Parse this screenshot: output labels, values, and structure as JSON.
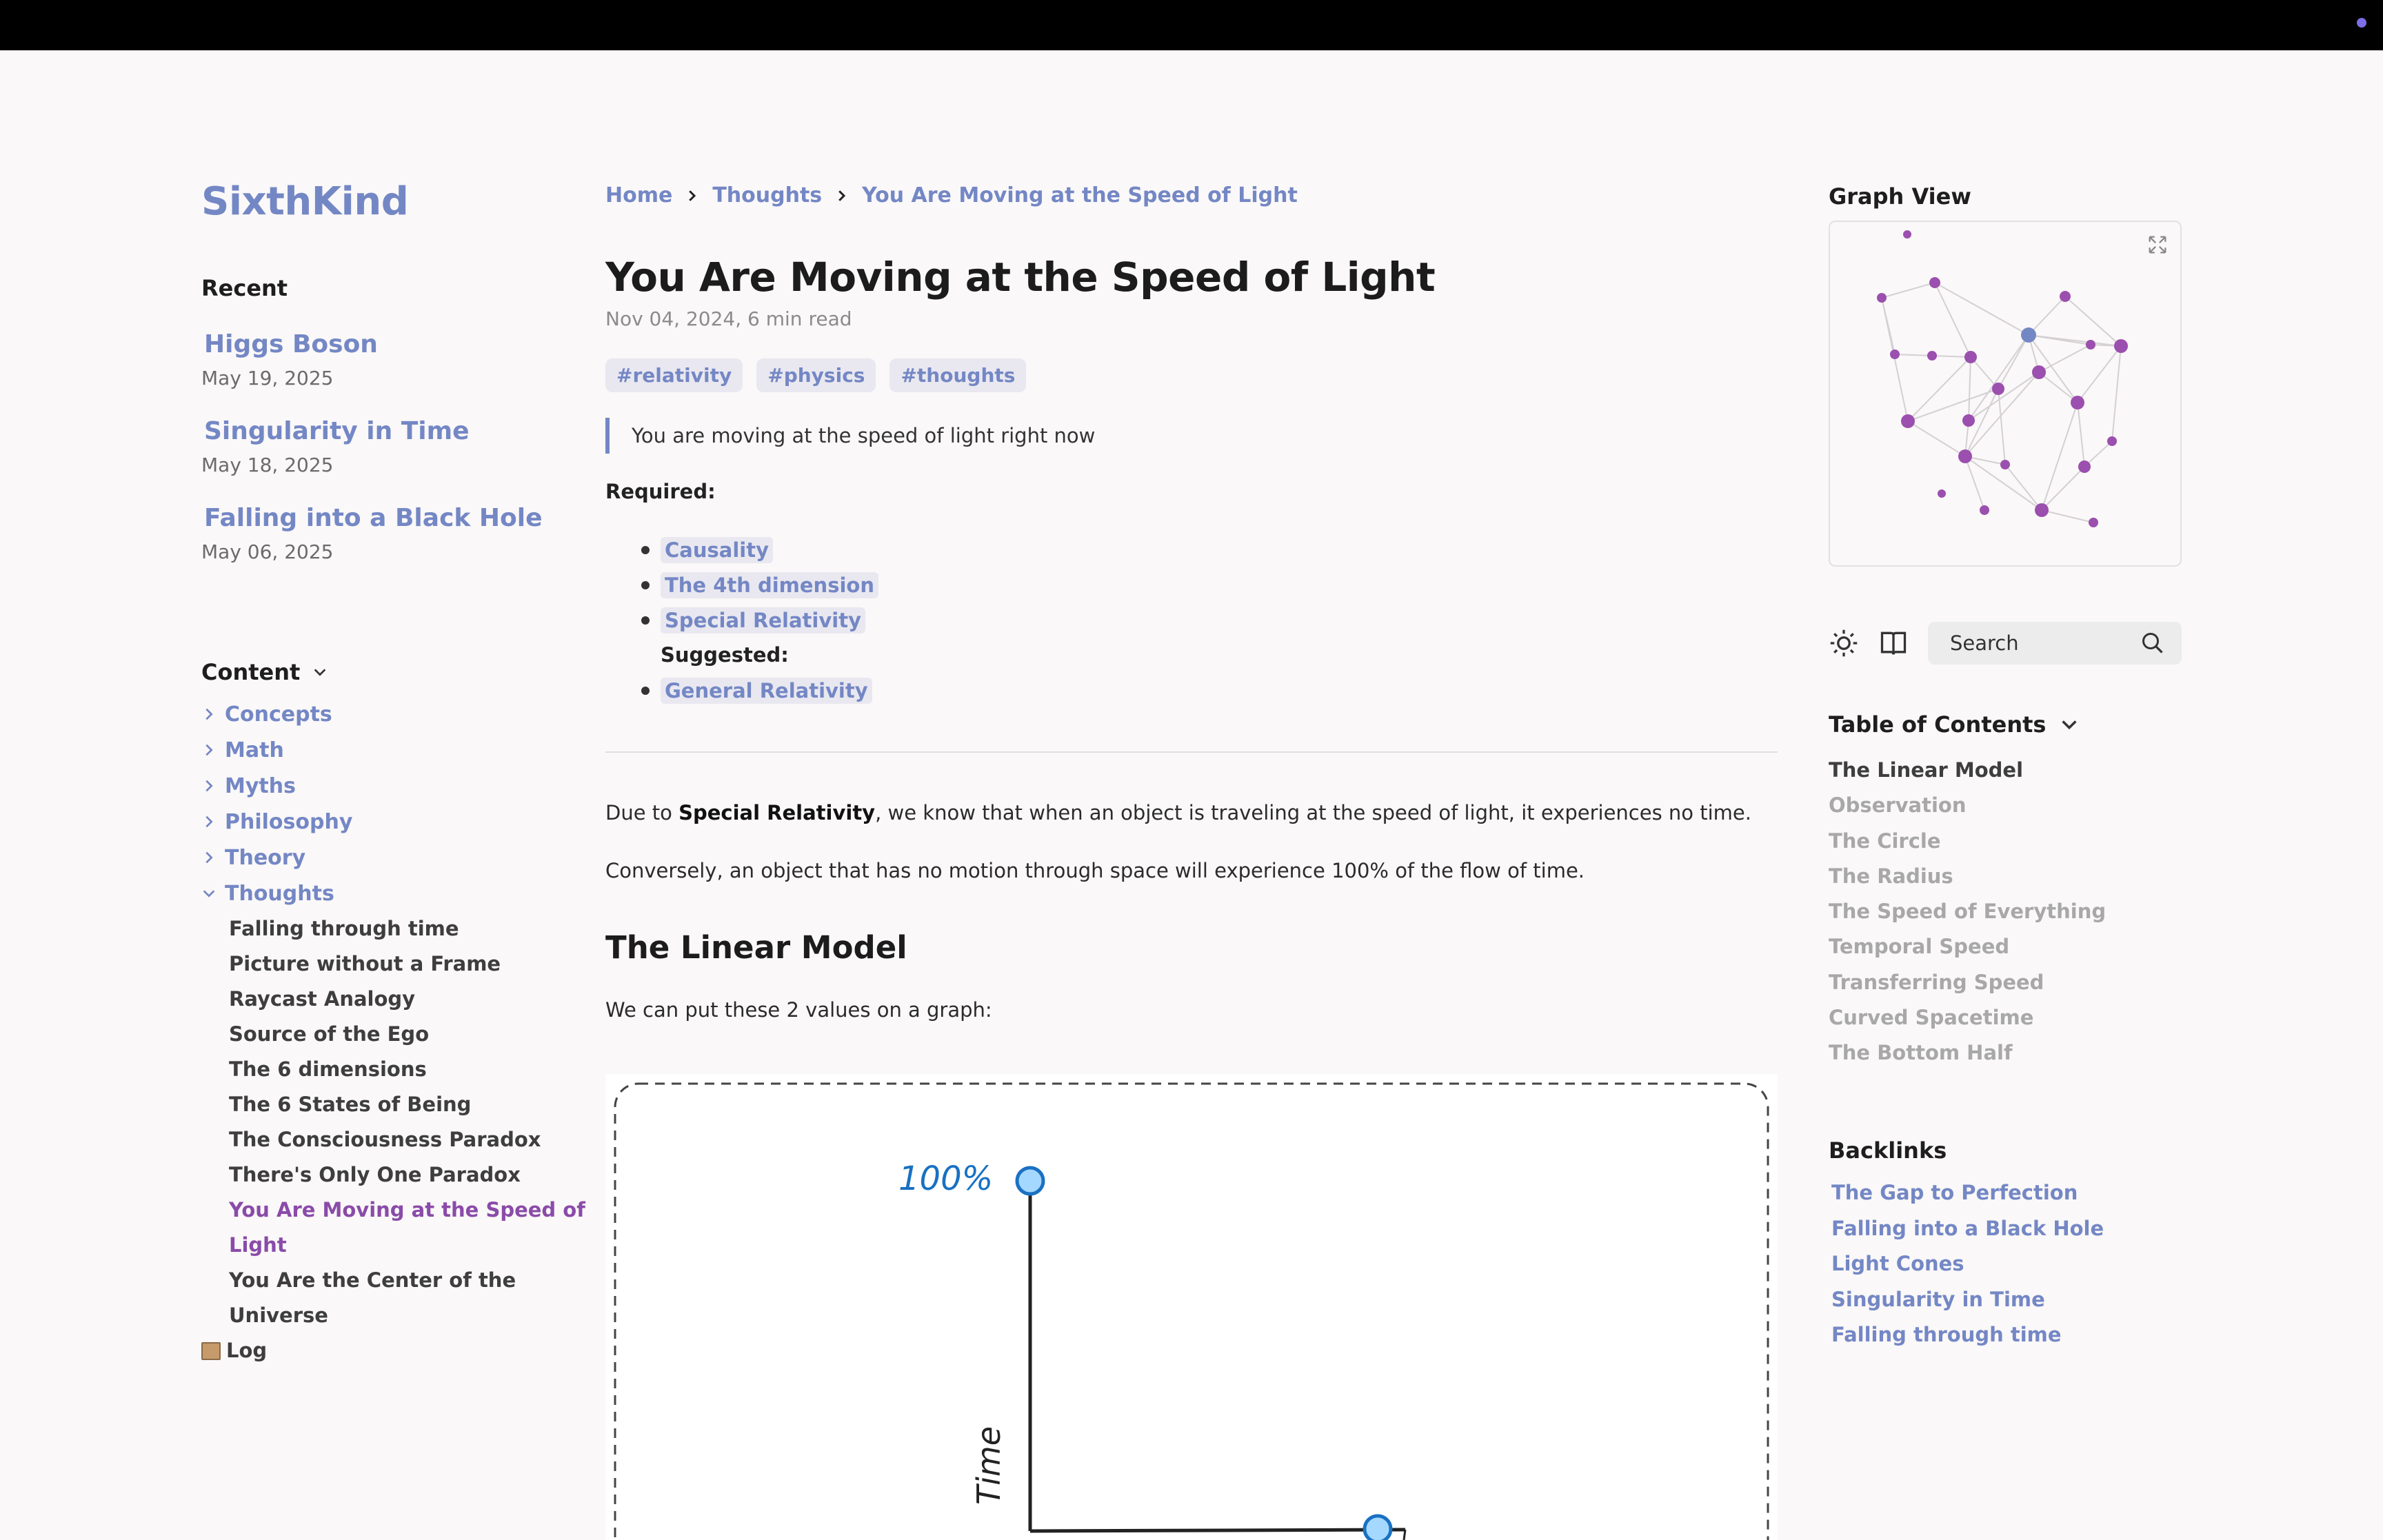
{
  "site": {
    "title": "SixthKind"
  },
  "recent": {
    "heading": "Recent",
    "items": [
      {
        "title": "Higgs Boson",
        "date": "May 19, 2025"
      },
      {
        "title": "Singularity in Time",
        "date": "May 18, 2025"
      },
      {
        "title": "Falling into a Black Hole",
        "date": "May 06, 2025"
      }
    ]
  },
  "content_nav": {
    "heading": "Content",
    "folders": [
      "Concepts",
      "Math",
      "Myths",
      "Philosophy",
      "Theory",
      "Thoughts"
    ],
    "thoughts_children": [
      "Falling through time",
      "Picture without a Frame",
      "Raycast Analogy",
      "Source of the Ego",
      "The 6 dimensions",
      "The 6 States of Being",
      "The Consciousness Paradox",
      "There's Only One Paradox",
      "You Are Moving at the Speed of",
      "Light",
      "You Are the Center of the Universe"
    ],
    "log": "Log"
  },
  "breadcrumb": [
    "Home",
    "Thoughts",
    "You Are Moving at the Speed of Light"
  ],
  "article": {
    "title": "You Are Moving at the Speed of Light",
    "meta": "Nov 04, 2024,   6 min read",
    "tags": [
      "#relativity",
      "#physics",
      "#thoughts"
    ],
    "quote": "You are moving at the speed of light right now",
    "required_label": "Required:",
    "required_links": [
      "Causality",
      "The 4th dimension",
      "Special Relativity"
    ],
    "suggested_label": "Suggested:",
    "suggested_links": [
      "General Relativity"
    ],
    "para1_pre": "Due to ",
    "para1_bold": "Special Relativity",
    "para1_post": ", we know that when an object is traveling at the speed of light, it experiences no time.",
    "para2": "Conversely, an object that has no motion through space will experience 100% of the flow of time.",
    "h2": "The Linear Model",
    "para3": "We can put these 2 values on a graph:",
    "figure": {
      "top_label": "100%",
      "y_axis_label": "Time"
    }
  },
  "right": {
    "graph_heading": "Graph View",
    "search_placeholder": "Search",
    "toc_heading": "Table of Contents",
    "toc": [
      "The Linear Model",
      "Observation",
      "The Circle",
      "The Radius",
      "The Speed of Everything",
      "Temporal Speed",
      "Transferring Speed",
      "Curved Spacetime",
      "The Bottom Half"
    ],
    "backlinks_heading": "Backlinks",
    "backlinks": [
      "The Gap to Perfection",
      "Falling into a Black Hole",
      "Light Cones",
      "Singularity in Time",
      "Falling through time"
    ]
  },
  "colors": {
    "accent": "#7487c5",
    "active": "#8a4ba9",
    "graph_node": "#9b4fae"
  }
}
